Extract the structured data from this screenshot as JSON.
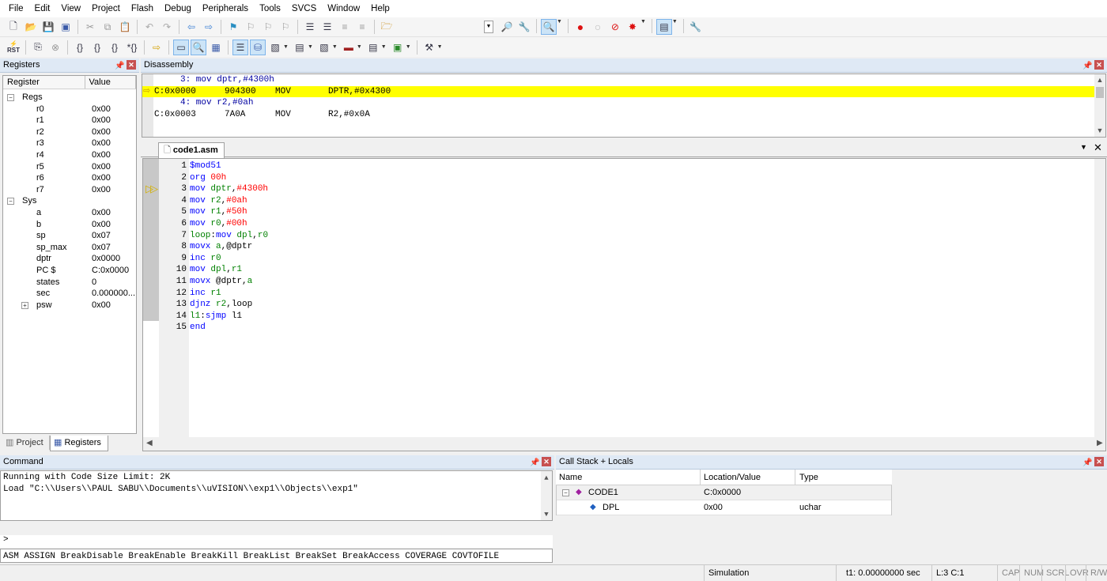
{
  "menu": [
    "File",
    "Edit",
    "View",
    "Project",
    "Flash",
    "Debug",
    "Peripherals",
    "Tools",
    "SVCS",
    "Window",
    "Help"
  ],
  "toolbar_icons": {
    "row1": [
      "new-file-icon",
      "open-file-icon",
      "save-icon",
      "save-all-icon",
      "cut-icon",
      "copy-icon",
      "paste-icon",
      "undo-icon",
      "redo-icon",
      "back-icon",
      "forward-icon",
      "bookmark-icon",
      "bookmark-prev-icon",
      "bookmark-next-icon",
      "bookmark-clear-icon",
      "indent-icon",
      "unindent-icon",
      "comment-icon",
      "uncomment-icon",
      "find-in-files-icon"
    ],
    "row2": [
      "reset-icon",
      "run-icon",
      "stop-icon",
      "step-into-icon",
      "step-over-icon",
      "step-out-icon",
      "run-to-cursor-icon",
      "show-next-statement-icon",
      "command-window-icon",
      "disassembly-window-icon",
      "symbols-window-icon",
      "registers-window-icon",
      "call-stack-icon",
      "watch-window-icon",
      "memory-window-icon",
      "serial-window-icon",
      "analysis-window-icon",
      "trace-window-icon",
      "system-viewer-icon",
      "toolbox-icon"
    ]
  },
  "registers": {
    "title": "Registers",
    "col_register": "Register",
    "col_value": "Value",
    "groups": [
      {
        "name": "Regs",
        "items": [
          {
            "name": "r0",
            "value": "0x00"
          },
          {
            "name": "r1",
            "value": "0x00"
          },
          {
            "name": "r2",
            "value": "0x00"
          },
          {
            "name": "r3",
            "value": "0x00"
          },
          {
            "name": "r4",
            "value": "0x00"
          },
          {
            "name": "r5",
            "value": "0x00"
          },
          {
            "name": "r6",
            "value": "0x00"
          },
          {
            "name": "r7",
            "value": "0x00"
          }
        ]
      },
      {
        "name": "Sys",
        "items": [
          {
            "name": "a",
            "value": "0x00"
          },
          {
            "name": "b",
            "value": "0x00"
          },
          {
            "name": "sp",
            "value": "0x07"
          },
          {
            "name": "sp_max",
            "value": "0x07"
          },
          {
            "name": "dptr",
            "value": "0x0000"
          },
          {
            "name": "PC  $",
            "value": "C:0x0000"
          },
          {
            "name": "states",
            "value": "0"
          },
          {
            "name": "sec",
            "value": "0.000000..."
          },
          {
            "name": "psw",
            "value": "0x00"
          }
        ]
      }
    ],
    "tab_project": "Project",
    "tab_registers": "Registers"
  },
  "disassembly": {
    "title": "Disassembly",
    "lines": [
      {
        "kind": "src",
        "text": "     3: mov dptr,#4300h"
      },
      {
        "kind": "cur",
        "addr": "C:0x0000",
        "bytes": "904300",
        "op": "MOV",
        "args": "DPTR,#0x4300"
      },
      {
        "kind": "src",
        "text": "     4: mov r2,#0ah"
      },
      {
        "kind": "asm",
        "addr": "C:0x0003",
        "bytes": "7A0A",
        "op": "MOV",
        "args": "R2,#0x0A"
      }
    ]
  },
  "editor": {
    "tab": "code1.asm",
    "lines": [
      {
        "n": "1",
        "tokens": [
          {
            "t": "$mod51",
            "c": "dir"
          }
        ]
      },
      {
        "n": "2",
        "tokens": [
          {
            "t": "org ",
            "c": "kw"
          },
          {
            "t": "00h",
            "c": "num"
          }
        ]
      },
      {
        "n": "3",
        "tokens": [
          {
            "t": "mov ",
            "c": "kw"
          },
          {
            "t": "dptr",
            "c": "cmt"
          },
          {
            "t": ",",
            "c": ""
          },
          {
            "t": "#4300h",
            "c": "num"
          }
        ]
      },
      {
        "n": "4",
        "tokens": [
          {
            "t": "mov ",
            "c": "kw"
          },
          {
            "t": "r2",
            "c": "cmt"
          },
          {
            "t": ",",
            "c": ""
          },
          {
            "t": "#0ah",
            "c": "num"
          }
        ]
      },
      {
        "n": "5",
        "tokens": [
          {
            "t": "mov ",
            "c": "kw"
          },
          {
            "t": "r1",
            "c": "cmt"
          },
          {
            "t": ",",
            "c": ""
          },
          {
            "t": "#50h",
            "c": "num"
          }
        ]
      },
      {
        "n": "6",
        "tokens": [
          {
            "t": "mov ",
            "c": "kw"
          },
          {
            "t": "r0",
            "c": "cmt"
          },
          {
            "t": ",",
            "c": ""
          },
          {
            "t": "#00h",
            "c": "num"
          }
        ]
      },
      {
        "n": "7",
        "tokens": [
          {
            "t": "loop",
            "c": "cmt"
          },
          {
            "t": ":",
            "c": ""
          },
          {
            "t": "mov ",
            "c": "kw"
          },
          {
            "t": "dpl",
            "c": "cmt"
          },
          {
            "t": ",",
            "c": ""
          },
          {
            "t": "r0",
            "c": "cmt"
          }
        ]
      },
      {
        "n": "8",
        "tokens": [
          {
            "t": "movx ",
            "c": "kw"
          },
          {
            "t": "a",
            "c": "cmt"
          },
          {
            "t": ",@dptr",
            "c": ""
          }
        ]
      },
      {
        "n": "9",
        "tokens": [
          {
            "t": "inc ",
            "c": "kw"
          },
          {
            "t": "r0",
            "c": "cmt"
          }
        ]
      },
      {
        "n": "10",
        "tokens": [
          {
            "t": "mov ",
            "c": "kw"
          },
          {
            "t": "dpl",
            "c": "cmt"
          },
          {
            "t": ",",
            "c": ""
          },
          {
            "t": "r1",
            "c": "cmt"
          }
        ]
      },
      {
        "n": "11",
        "tokens": [
          {
            "t": "movx ",
            "c": "kw"
          },
          {
            "t": "@dptr,",
            "c": ""
          },
          {
            "t": "a",
            "c": "cmt"
          }
        ]
      },
      {
        "n": "12",
        "tokens": [
          {
            "t": "inc ",
            "c": "kw"
          },
          {
            "t": "r1",
            "c": "cmt"
          }
        ]
      },
      {
        "n": "13",
        "tokens": [
          {
            "t": "djnz ",
            "c": "kw"
          },
          {
            "t": "r2",
            "c": "cmt"
          },
          {
            "t": ",loop",
            "c": ""
          }
        ]
      },
      {
        "n": "14",
        "tokens": [
          {
            "t": "l1",
            "c": "cmt"
          },
          {
            "t": ":",
            "c": ""
          },
          {
            "t": "sjmp ",
            "c": "kw"
          },
          {
            "t": "l1",
            "c": ""
          }
        ]
      },
      {
        "n": "15",
        "tokens": [
          {
            "t": "end",
            "c": "kw"
          }
        ]
      }
    ]
  },
  "command": {
    "title": "Command",
    "output": [
      "Running with Code Size Limit: 2K",
      "Load \"C:\\\\Users\\\\PAUL SABU\\\\Documents\\\\uVISION\\\\exp1\\\\Objects\\\\exp1\""
    ],
    "prompt": ">",
    "hint": "ASM ASSIGN BreakDisable BreakEnable BreakKill BreakList BreakSet BreakAccess COVERAGE COVTOFILE"
  },
  "callstack": {
    "title": "Call Stack + Locals",
    "col_name": "Name",
    "col_loc": "Location/Value",
    "col_type": "Type",
    "rows": [
      {
        "name": "CODE1",
        "loc": "C:0x0000",
        "type": ""
      },
      {
        "name": "DPL",
        "loc": "0x00",
        "type": "uchar"
      }
    ]
  },
  "status": {
    "mode": "Simulation",
    "time": "t1: 0.00000000 sec",
    "pos": "L:3 C:1",
    "caps": "CAP",
    "num": "NUM",
    "scrl": "SCRL",
    "ovr": "OVR",
    "rw": "R/W"
  },
  "colors": {
    "current_line": "#ffff00",
    "keyword": "#0000ff",
    "number": "#ff0000",
    "identifier": "#008000"
  }
}
